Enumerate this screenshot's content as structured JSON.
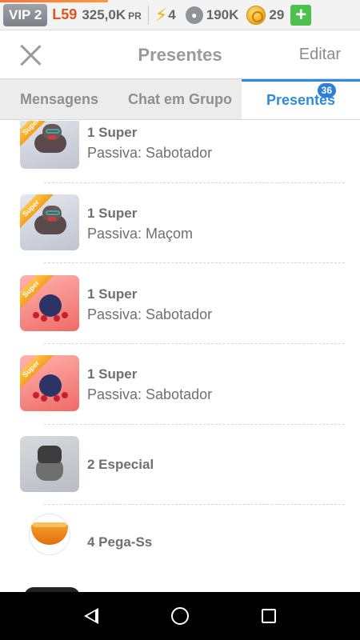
{
  "topbar": {
    "vip": "VIP 2",
    "level": "L59",
    "pr_value": "325,0K",
    "pr_unit": "PR",
    "energy": "4",
    "paws": "190K",
    "coins": "29",
    "plus_label": "+"
  },
  "header": {
    "title": "Presentes",
    "edit": "Editar"
  },
  "tabs": [
    {
      "label": "Mensagens"
    },
    {
      "label": "Chat em Grupo"
    },
    {
      "label": "Presentes",
      "badge": "36"
    }
  ],
  "gifts": [
    {
      "title": "1 Super",
      "subtitle": "Passiva: Sabotador",
      "ribbon": "Super",
      "image": "dog-creature-icon"
    },
    {
      "title": "1 Super",
      "subtitle": "Passiva: Maçom",
      "ribbon": "Super",
      "image": "dog-creature-icon"
    },
    {
      "title": "1 Super",
      "subtitle": "Passiva: Sabotador",
      "ribbon": "Super",
      "image": "spider-creature-icon"
    },
    {
      "title": "1 Super",
      "subtitle": "Passiva: Sabotador",
      "ribbon": "Super",
      "image": "spider-creature-icon"
    },
    {
      "title": "2 Especial",
      "image": "gray-dog-icon"
    },
    {
      "title": "4 Pega-Ss",
      "image": "bowl-icon"
    }
  ],
  "colors": {
    "accent": "#2f8be0",
    "level": "#e2531d",
    "plus": "#4cc14d"
  }
}
